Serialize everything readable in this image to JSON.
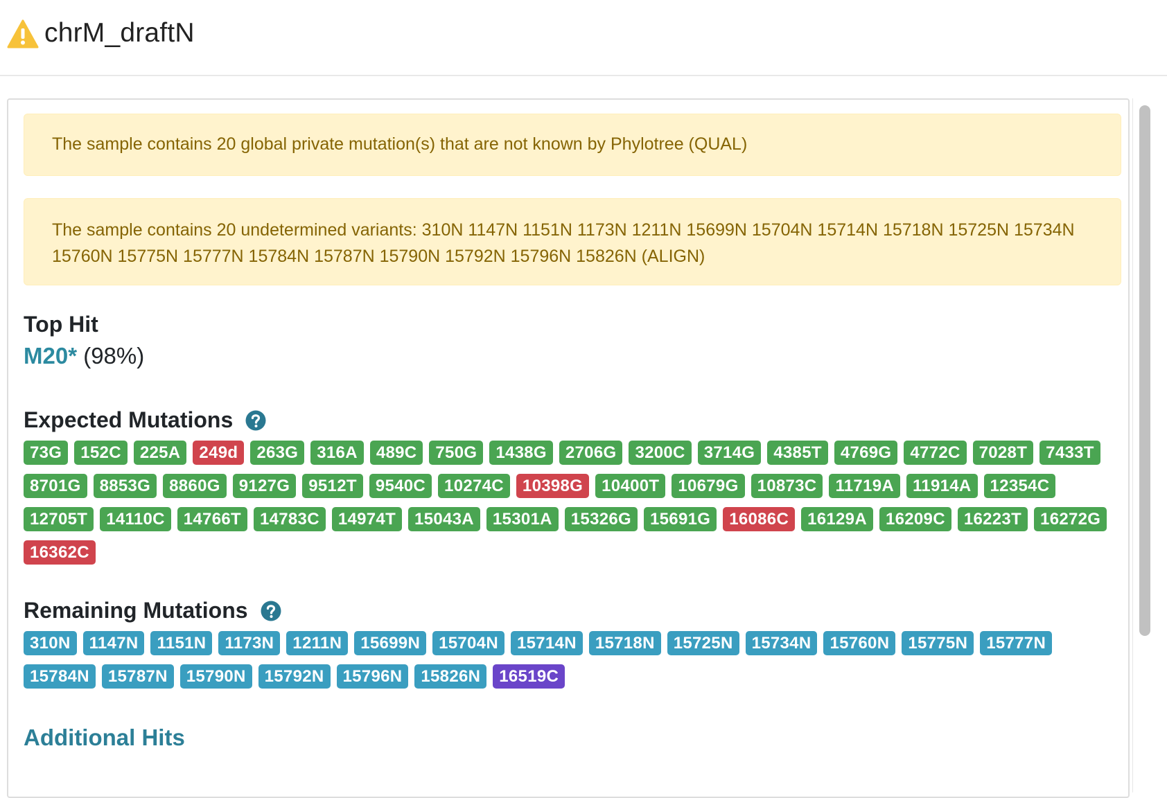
{
  "header": {
    "title": "chrM_draftN",
    "icon": "warning-icon"
  },
  "alerts": [
    "The sample contains 20 global private mutation(s) that are not known by Phylotree (QUAL)",
    "The sample contains 20 undetermined variants: 310N 1147N 1151N 1173N 1211N 15699N 15704N 15714N 15718N 15725N 15734N 15760N 15775N 15777N 15784N 15787N 15790N 15792N 15796N 15826N (ALIGN)"
  ],
  "top_hit": {
    "title": "Top Hit",
    "haplogroup": "M20*",
    "quality": "(98%)"
  },
  "expected": {
    "title": "Expected Mutations",
    "help_icon": "question-circle-icon",
    "mutations": [
      {
        "label": "73G",
        "status": "found"
      },
      {
        "label": "152C",
        "status": "found"
      },
      {
        "label": "225A",
        "status": "found"
      },
      {
        "label": "249d",
        "status": "missing"
      },
      {
        "label": "263G",
        "status": "found"
      },
      {
        "label": "316A",
        "status": "found"
      },
      {
        "label": "489C",
        "status": "found"
      },
      {
        "label": "750G",
        "status": "found"
      },
      {
        "label": "1438G",
        "status": "found"
      },
      {
        "label": "2706G",
        "status": "found"
      },
      {
        "label": "3200C",
        "status": "found"
      },
      {
        "label": "3714G",
        "status": "found"
      },
      {
        "label": "4385T",
        "status": "found"
      },
      {
        "label": "4769G",
        "status": "found"
      },
      {
        "label": "4772C",
        "status": "found"
      },
      {
        "label": "7028T",
        "status": "found"
      },
      {
        "label": "7433T",
        "status": "found"
      },
      {
        "label": "8701G",
        "status": "found"
      },
      {
        "label": "8853G",
        "status": "found"
      },
      {
        "label": "8860G",
        "status": "found"
      },
      {
        "label": "9127G",
        "status": "found"
      },
      {
        "label": "9512T",
        "status": "found"
      },
      {
        "label": "9540C",
        "status": "found"
      },
      {
        "label": "10274C",
        "status": "found"
      },
      {
        "label": "10398G",
        "status": "missing"
      },
      {
        "label": "10400T",
        "status": "found"
      },
      {
        "label": "10679G",
        "status": "found"
      },
      {
        "label": "10873C",
        "status": "found"
      },
      {
        "label": "11719A",
        "status": "found"
      },
      {
        "label": "11914A",
        "status": "found"
      },
      {
        "label": "12354C",
        "status": "found"
      },
      {
        "label": "12705T",
        "status": "found"
      },
      {
        "label": "14110C",
        "status": "found"
      },
      {
        "label": "14766T",
        "status": "found"
      },
      {
        "label": "14783C",
        "status": "found"
      },
      {
        "label": "14974T",
        "status": "found"
      },
      {
        "label": "15043A",
        "status": "found"
      },
      {
        "label": "15301A",
        "status": "found"
      },
      {
        "label": "15326G",
        "status": "found"
      },
      {
        "label": "15691G",
        "status": "found"
      },
      {
        "label": "16086C",
        "status": "missing"
      },
      {
        "label": "16129A",
        "status": "found"
      },
      {
        "label": "16209C",
        "status": "found"
      },
      {
        "label": "16223T",
        "status": "found"
      },
      {
        "label": "16272G",
        "status": "found"
      },
      {
        "label": "16362C",
        "status": "missing"
      }
    ]
  },
  "remaining": {
    "title": "Remaining Mutations",
    "help_icon": "question-circle-icon",
    "mutations": [
      {
        "label": "310N",
        "status": "undetermined"
      },
      {
        "label": "1147N",
        "status": "undetermined"
      },
      {
        "label": "1151N",
        "status": "undetermined"
      },
      {
        "label": "1173N",
        "status": "undetermined"
      },
      {
        "label": "1211N",
        "status": "undetermined"
      },
      {
        "label": "15699N",
        "status": "undetermined"
      },
      {
        "label": "15704N",
        "status": "undetermined"
      },
      {
        "label": "15714N",
        "status": "undetermined"
      },
      {
        "label": "15718N",
        "status": "undetermined"
      },
      {
        "label": "15725N",
        "status": "undetermined"
      },
      {
        "label": "15734N",
        "status": "undetermined"
      },
      {
        "label": "15760N",
        "status": "undetermined"
      },
      {
        "label": "15775N",
        "status": "undetermined"
      },
      {
        "label": "15777N",
        "status": "undetermined"
      },
      {
        "label": "15784N",
        "status": "undetermined"
      },
      {
        "label": "15787N",
        "status": "undetermined"
      },
      {
        "label": "15790N",
        "status": "undetermined"
      },
      {
        "label": "15792N",
        "status": "undetermined"
      },
      {
        "label": "15796N",
        "status": "undetermined"
      },
      {
        "label": "15826N",
        "status": "undetermined"
      },
      {
        "label": "16519C",
        "status": "hotspot"
      }
    ]
  },
  "additional": {
    "title": "Additional Hits"
  },
  "colors": {
    "found": "#4aa552",
    "missing": "#d0444d",
    "undetermined": "#3a9ec0",
    "hotspot": "#6a45c9",
    "link": "#2c8aa0",
    "help": "#2a7891",
    "warning": "#f7c23a"
  }
}
